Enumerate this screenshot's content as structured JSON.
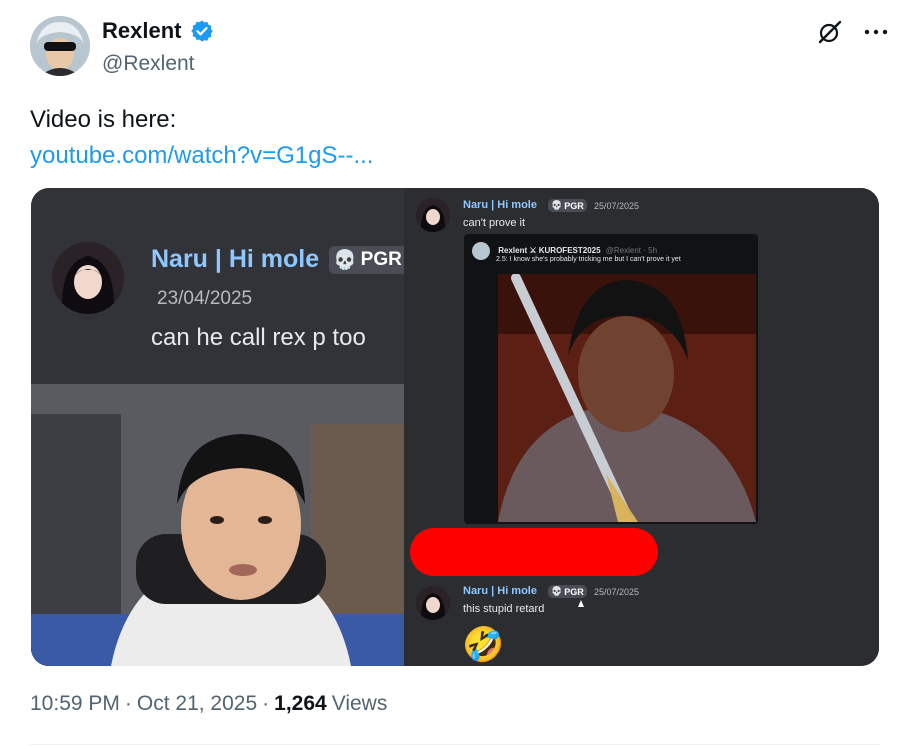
{
  "author": {
    "display_name": "Rexlent",
    "handle": "@Rexlent",
    "verified": true,
    "verified_color": "#1d9bf0",
    "avatar_icon": "avatar-icon"
  },
  "actions": {
    "grok_icon": "grok-icon",
    "more_icon": "more-icon"
  },
  "tweet": {
    "text": "Video is here:",
    "link": "youtube.com/watch?v=G1gS--..."
  },
  "media": {
    "left_message": {
      "name": "Naru | Hi mole",
      "tag": "PGR",
      "date": "23/04/2025",
      "text": "can he call rex p too"
    },
    "right_top_message": {
      "name": "Naru | Hi mole",
      "tag": "PGR",
      "date": "25/07/2025",
      "text": "can't prove it"
    },
    "embed": {
      "author": "Rexlent ⚔ KUROFEST2025",
      "handle_time": "@Rexlent · 5h",
      "text": "2.5: I know she's probably tricking me but I can't prove it yet"
    },
    "right_bottom_message": {
      "name": "Naru | Hi mole",
      "tag": "PGR",
      "date": "25/07/2025",
      "text": "this stupid retard",
      "emoji": "🤣"
    }
  },
  "footer": {
    "time": "10:59 PM",
    "sep1": "·",
    "date": "Oct 21, 2025",
    "sep2": "·",
    "views_count": "1,264",
    "views_label": "Views"
  }
}
